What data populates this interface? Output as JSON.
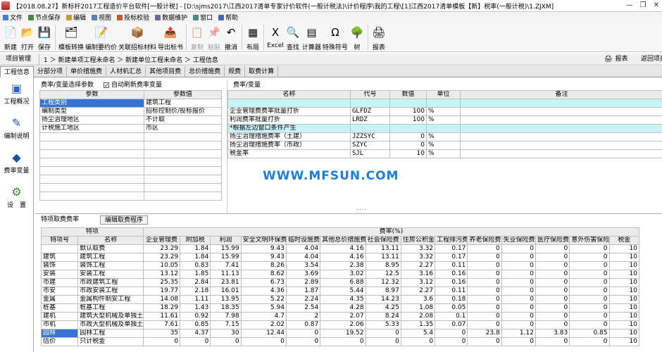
{
  "title": "【2018.08.27】新标杆2017工程造价平台软件[一般计税] - [D:\\sjms2017\\江西2017清单专家计价软件(一般计税法)\\计价程序\\我的工程\\[1]江西2017清单模板【新】税率(一般计税)\\1.ZJXM]",
  "menu": [
    {
      "label": "文件",
      "icon": "#4a7ec2"
    },
    {
      "label": "节点保存",
      "icon": "#3f8a3f"
    },
    {
      "label": "编辑",
      "icon": "#c89c2a"
    },
    {
      "label": "视图",
      "icon": "#5b7fb0"
    },
    {
      "label": "投标校验",
      "icon": "#c45a2a"
    },
    {
      "label": "数据维护",
      "icon": "#6a6a9a"
    },
    {
      "label": "窗口",
      "icon": "#4a8a8a"
    },
    {
      "label": "帮助",
      "icon": "#3a6ab0"
    }
  ],
  "toolbar": [
    {
      "label": "新建",
      "icon": "📄",
      "disabled": false
    },
    {
      "label": "打开",
      "icon": "📂",
      "disabled": false
    },
    {
      "label": "保存",
      "icon": "💾",
      "disabled": false
    },
    {
      "label": "模板转换",
      "icon": "🗂",
      "disabled": false
    },
    {
      "label": "编制要约价",
      "icon": "📝",
      "disabled": false
    },
    {
      "label": "关联招标材料",
      "icon": "📦",
      "disabled": false
    },
    {
      "label": "导出标书",
      "icon": "📤",
      "disabled": false
    },
    {
      "label": "复制",
      "icon": "📋",
      "disabled": true
    },
    {
      "label": "粘贴",
      "icon": "📌",
      "disabled": true
    },
    {
      "label": "撤消",
      "icon": "↶",
      "disabled": false
    },
    {
      "label": "布局",
      "icon": "▦",
      "disabled": false
    },
    {
      "label": "Excel",
      "icon": "X",
      "disabled": false
    },
    {
      "label": "查找",
      "icon": "🔍",
      "disabled": false
    },
    {
      "label": "计算器",
      "icon": "▤",
      "disabled": false
    },
    {
      "label": "特殊符号",
      "icon": "Ω",
      "disabled": false
    },
    {
      "label": "树",
      "icon": "🌳",
      "disabled": false
    },
    {
      "label": "报表",
      "icon": "🖨",
      "disabled": false
    }
  ],
  "nav": {
    "project_mgmt": "项目管理",
    "breadcrumb": "1 ＞ 新建单项工程未命名 ＞ 新建单位工程未命名 ＞ 工程信息",
    "report": "报表",
    "back": "返回项目"
  },
  "tabs": [
    "工程信息",
    "分部分项",
    "单价措施费",
    "人材机汇总",
    "其他项目费",
    "总价措施费",
    "规费",
    "取费计算"
  ],
  "leftnav": [
    {
      "label": "工程概况",
      "icon": "overview"
    },
    {
      "label": "编制说明",
      "icon": "edit"
    },
    {
      "label": "费率变量",
      "icon": "rate"
    },
    {
      "label": "设　置",
      "icon": "settings"
    }
  ],
  "params_panel": {
    "title": "费率/变量选择参数",
    "checkbox_label": "自动刷新费率变量",
    "checked": true,
    "headers": [
      "参数",
      "参数值"
    ],
    "rows": [
      [
        "工程类别",
        "建筑工程"
      ],
      [
        "编制类型",
        "招标控制价/投标报价"
      ],
      [
        "扬尘治理地区",
        "不计取"
      ],
      [
        "计税施工地区",
        "市区"
      ]
    ]
  },
  "rates_panel": {
    "title": "费率/变量",
    "headers": [
      "名称",
      "代号",
      "数值",
      "单位",
      "备注"
    ],
    "rows": [
      {
        "name": "",
        "code": "",
        "value": "",
        "unit": "",
        "note": "",
        "style": "cyan"
      },
      {
        "name": "企业管理费费率批量打折",
        "code": "GLFDZ",
        "value": "100",
        "unit": "%",
        "note": "",
        "style": ""
      },
      {
        "name": "利润费率批量打折",
        "code": "LRDZ",
        "value": "100",
        "unit": "%",
        "note": "",
        "style": ""
      },
      {
        "name": "*根据左边窗口条件产生",
        "code": "",
        "value": "",
        "unit": "",
        "note": "",
        "style": "cyan"
      },
      {
        "name": "扬尘治理措施费率（土建）",
        "code": "JZZSYC",
        "value": "0",
        "unit": "%",
        "note": "",
        "style": ""
      },
      {
        "name": "扬尘治理措施费率（市政）",
        "code": "SZYC",
        "value": "0",
        "unit": "%",
        "note": "",
        "style": ""
      },
      {
        "name": "税金率",
        "code": "SJL",
        "value": "10",
        "unit": "%",
        "note": "",
        "style": ""
      }
    ]
  },
  "watermark": "WWW.MFSUN.COM",
  "bottom": {
    "title": "特项取费费率",
    "edit_button": "编辑取费程序",
    "group_header": "特项",
    "rate_header": "费率(%)",
    "col_headers": [
      "特项号",
      "名称",
      "企业管理费",
      "附加税",
      "利润",
      "安全文明环保费",
      "临时设施费",
      "其他总价措施费",
      "社会保险费",
      "住房公积金",
      "工程排污费",
      "养老保险费",
      "失业保险费",
      "医疗保险费",
      "意外伤害保险",
      "税金"
    ],
    "rows": [
      [
        "",
        "默认取费",
        "23.29",
        "1.84",
        "15.99",
        "9.43",
        "4.04",
        "4.16",
        "13.11",
        "3.32",
        "0.17",
        "0",
        "0",
        "0",
        "0",
        "10"
      ],
      [
        "建筑",
        "建筑工程",
        "23.29",
        "1.84",
        "15.99",
        "9.43",
        "4.04",
        "4.16",
        "13.11",
        "3.32",
        "0.17",
        "0",
        "0",
        "0",
        "0",
        "10"
      ],
      [
        "装饰",
        "装饰工程",
        "10.05",
        "0.83",
        "7.41",
        "8.26",
        "3.54",
        "2.38",
        "8.95",
        "2.27",
        "0.11",
        "0",
        "0",
        "0",
        "0",
        "10"
      ],
      [
        "安装",
        "安装工程",
        "13.12",
        "1.85",
        "11.13",
        "8.62",
        "3.69",
        "3.02",
        "12.5",
        "3.16",
        "0.16",
        "0",
        "0",
        "0",
        "0",
        "10"
      ],
      [
        "市建",
        "市政建筑工程",
        "25.35",
        "2.84",
        "23.81",
        "6.73",
        "2.89",
        "6.88",
        "12.32",
        "3.12",
        "0.16",
        "0",
        "0",
        "0",
        "0",
        "10"
      ],
      [
        "市安",
        "市政安装工程",
        "19.77",
        "2.18",
        "16.01",
        "4.36",
        "1.87",
        "5.44",
        "8.97",
        "2.27",
        "0.11",
        "0",
        "0",
        "0",
        "0",
        "10"
      ],
      [
        "金属",
        "金属构件制安工程",
        "14.08",
        "1.11",
        "13.95",
        "5.22",
        "2.24",
        "4.35",
        "14.23",
        "3.6",
        "0.18",
        "0",
        "0",
        "0",
        "0",
        "10"
      ],
      [
        "桩基",
        "桩基工程",
        "18.29",
        "1.43",
        "18.35",
        "5.94",
        "2.54",
        "4.28",
        "4.25",
        "1.08",
        "0.05",
        "0",
        "0",
        "0",
        "0",
        "10"
      ],
      [
        "建机",
        "建筑大型机械及单独土石",
        "11.61",
        "0.92",
        "7.98",
        "4.7",
        "2",
        "2.07",
        "8.24",
        "2.08",
        "0.1",
        "0",
        "0",
        "0",
        "0",
        "10"
      ],
      [
        "市机",
        "市政大型机械及单独土石",
        "7.61",
        "0.85",
        "7.15",
        "2.02",
        "0.87",
        "2.06",
        "5.33",
        "1.35",
        "0.07",
        "0",
        "0",
        "0",
        "0",
        "10"
      ],
      [
        "园林",
        "园林工程",
        "35",
        "4.37",
        "30",
        "12.44",
        "0",
        "19.52",
        "0",
        "5.4",
        "0",
        "23.8",
        "1.12",
        "3.83",
        "0.85",
        "10"
      ],
      [
        "估价",
        "只计税金",
        "0",
        "0",
        "0",
        "0",
        "0",
        "0",
        "0",
        "0",
        "0",
        "0",
        "0",
        "0",
        "0",
        "10"
      ]
    ]
  }
}
